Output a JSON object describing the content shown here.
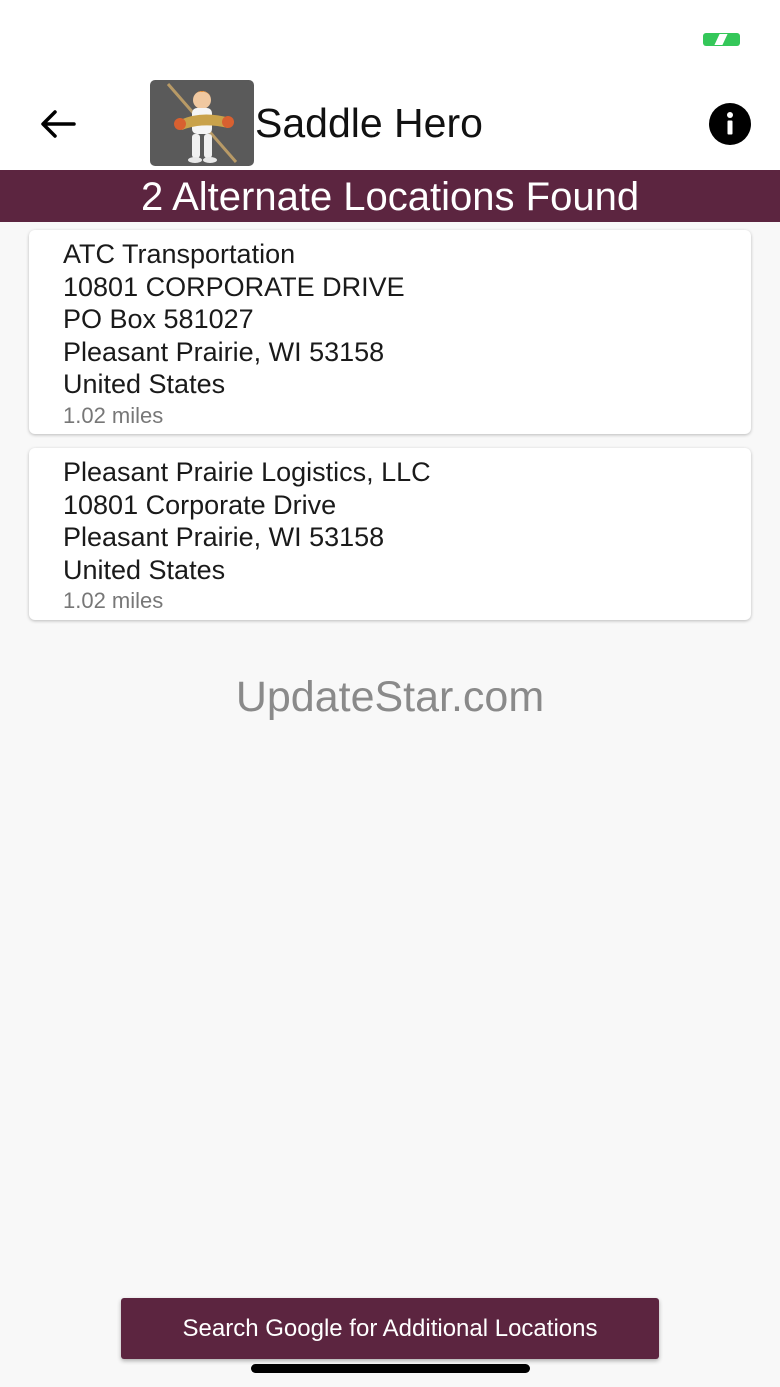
{
  "header": {
    "app_title": "Saddle Hero"
  },
  "banner": {
    "text": "2 Alternate Locations Found"
  },
  "locations": [
    {
      "name": "ATC Transportation",
      "address_line1": "10801 CORPORATE DRIVE",
      "address_line2": "PO Box 581027",
      "city_state_zip": "Pleasant Prairie, WI 53158",
      "country": "United States",
      "distance": "1.02 miles"
    },
    {
      "name": "Pleasant Prairie Logistics, LLC",
      "address_line1": "10801 Corporate Drive",
      "city_state_zip": "Pleasant Prairie, WI 53158",
      "country": "United States",
      "distance": "1.02 miles"
    }
  ],
  "watermark": "UpdateStar.com",
  "footer": {
    "search_google_label": "Search Google for Additional Locations"
  },
  "colors": {
    "brand": "#5c2540",
    "battery": "#34c759"
  },
  "icons": {
    "back": "back-arrow-icon",
    "info": "info-icon",
    "logo": "saddle-hero-logo"
  }
}
